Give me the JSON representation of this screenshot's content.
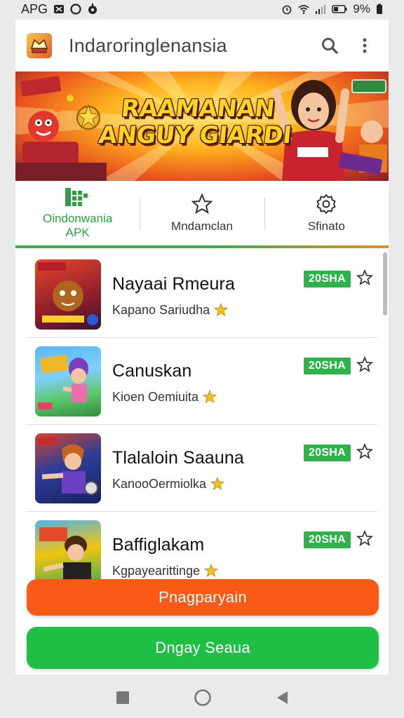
{
  "status_bar": {
    "carrier": "APG",
    "battery": "9%"
  },
  "app_bar": {
    "title": "Indaroringlenansia"
  },
  "banner": {
    "title_line1": "RAAMANAN",
    "title_line2": "ANGUY GIARDI"
  },
  "tabs": [
    {
      "label": "Oindonwania APK",
      "icon": "apk-grid-icon",
      "active": true
    },
    {
      "label": "Mndamclan",
      "icon": "star-icon",
      "active": false
    },
    {
      "label": "Sfinato",
      "icon": "gear-icon",
      "active": false
    }
  ],
  "apps": [
    {
      "title": "Nayaai Rmeura",
      "subtitle": "Kapano Sariudha",
      "badge": "20SHA",
      "thumb_colors": [
        "#c0392b",
        "#e67e22"
      ]
    },
    {
      "title": "Canuskan",
      "subtitle": "Kioen Oemiuita",
      "badge": "20SHA",
      "thumb_colors": [
        "#3fa7e0",
        "#5cc86a"
      ]
    },
    {
      "title": "Tlalaloin Saauna",
      "subtitle": "KanooOermiolka",
      "badge": "20SHA",
      "thumb_colors": [
        "#2c3e9a",
        "#f39c12"
      ]
    },
    {
      "title": "Baffiglakam",
      "subtitle": "Kgpayearittinge",
      "badge": "20SHA",
      "thumb_colors": [
        "#27ae60",
        "#f1c40f"
      ]
    }
  ],
  "buttons": {
    "primary": "Pnagparyain",
    "secondary": "Dngay Seaua"
  },
  "colors": {
    "accent_green": "#2db34a",
    "accent_orange": "#fb5a16"
  }
}
